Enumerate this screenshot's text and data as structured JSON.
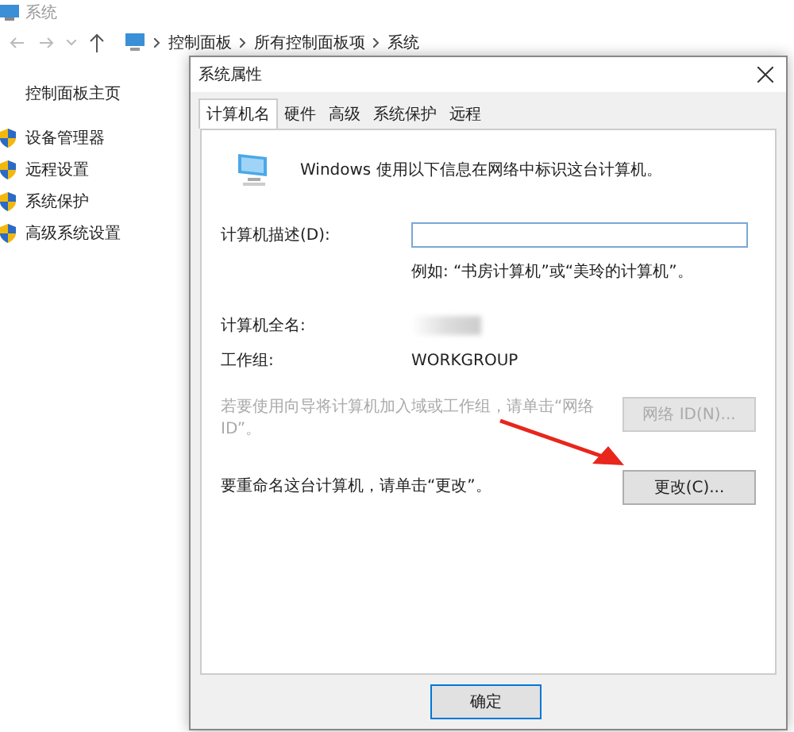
{
  "explorer": {
    "title": "系统",
    "breadcrumb": [
      "控制面板",
      "所有控制面板项",
      "系统"
    ],
    "sidebar": {
      "home": "控制面板主页",
      "items": [
        "设备管理器",
        "远程设置",
        "系统保护",
        "高级系统设置"
      ]
    }
  },
  "dialog": {
    "title": "系统属性",
    "tabs": [
      {
        "label": "计算机名",
        "selected": true
      },
      {
        "label": "硬件",
        "selected": false
      },
      {
        "label": "高级",
        "selected": false
      },
      {
        "label": "系统保护",
        "selected": false
      },
      {
        "label": "远程",
        "selected": false
      }
    ],
    "intro": "Windows 使用以下信息在网络中标识这台计算机。",
    "description_label": "计算机描述(D):",
    "description_example": "例如: “书房计算机”或“美玲的计算机”。",
    "full_name_label": "计算机全名:",
    "workgroup_label": "工作组:",
    "workgroup_value": "WORKGROUP",
    "network_text": "若要使用向导将计算机加入域或工作组，请单击“网络 ID”。",
    "network_button": {
      "label": "网络 ID(N)...",
      "disabled": true
    },
    "rename_text": "要重命名这台计算机，请单击“更改”。",
    "rename_button": {
      "label": "更改(C)...",
      "disabled": false
    },
    "footer_buttons": [
      "确定"
    ]
  }
}
